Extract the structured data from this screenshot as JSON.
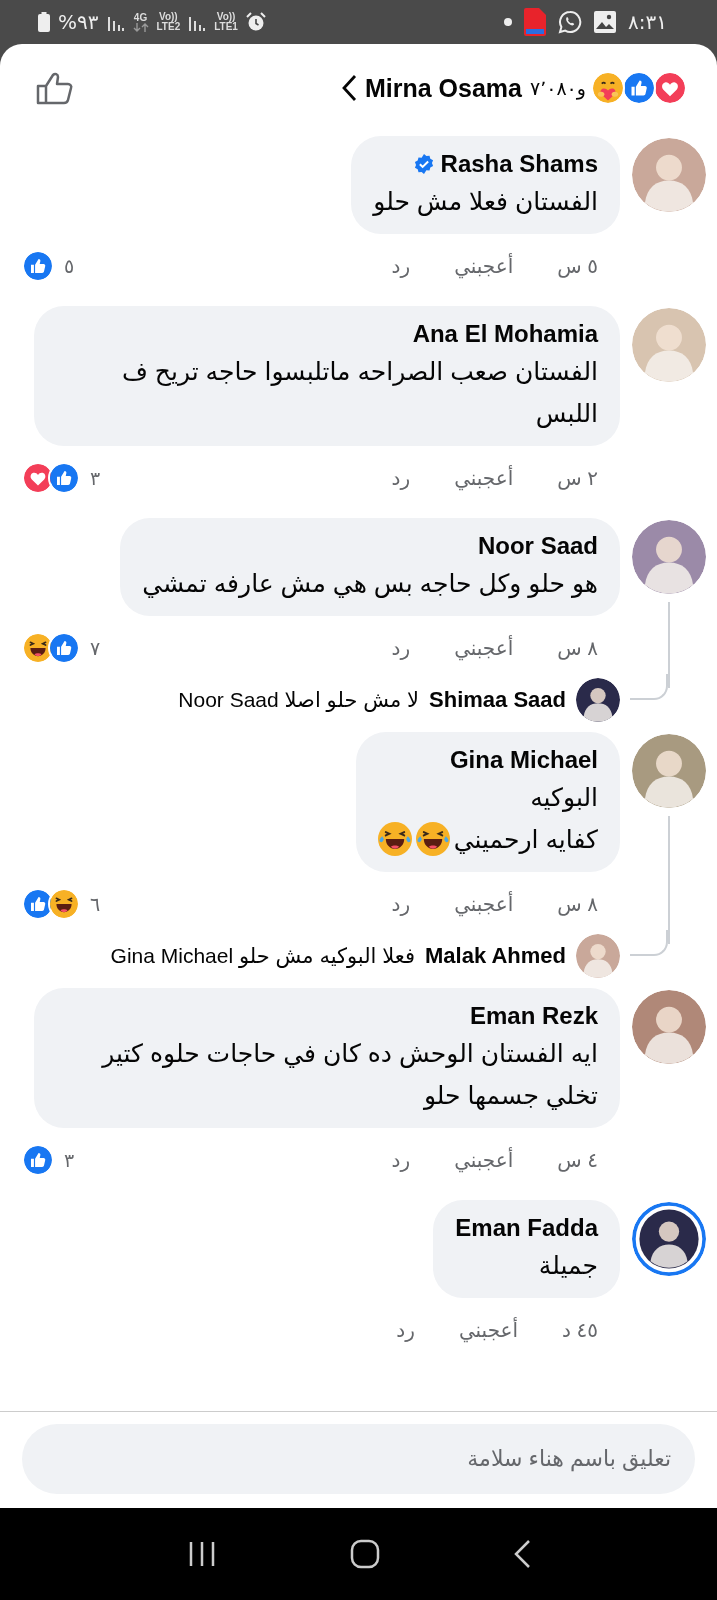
{
  "status_bar": {
    "time": "٨:٣١",
    "battery_text": "%٩٣",
    "network_type": "4G",
    "sim2_top": "Vo))",
    "sim2_bottom": "LTE2",
    "sim1_top": "Vo))",
    "sim1_bottom": "LTE1"
  },
  "header": {
    "reactions": [
      {
        "kind": "love"
      },
      {
        "kind": "like"
      },
      {
        "kind": "care"
      }
    ],
    "count": "و٧٬٠٨٠",
    "name": "Mirna Osama"
  },
  "comments": [
    {
      "name": "Rasha Shams",
      "verified": true,
      "story_ring": false,
      "lines": [
        "الفستان فعلا مش حلو"
      ],
      "time": "٥ س",
      "like_label": "أعجبني",
      "reply_label": "رد",
      "reactions": [
        {
          "kind": "like"
        }
      ],
      "reaction_count": "٥"
    },
    {
      "name": "Ana El Mohamia",
      "verified": false,
      "story_ring": false,
      "lines": [
        "الفستان صعب الصراحه ماتلبسوا حاجه تريح ف اللبس"
      ],
      "time": "٢ س",
      "like_label": "أعجبني",
      "reply_label": "رد",
      "reactions": [
        {
          "kind": "love"
        },
        {
          "kind": "like"
        }
      ],
      "reaction_count": "٣"
    },
    {
      "name": "Noor Saad",
      "verified": false,
      "story_ring": false,
      "lines": [
        "هو حلو وكل حاجه بس هي مش عارفه تمشي"
      ],
      "time": "٨ س",
      "like_label": "أعجبني",
      "reply_label": "رد",
      "reactions": [
        {
          "kind": "haha"
        },
        {
          "kind": "like"
        }
      ],
      "reaction_count": "٧",
      "replies": [
        {
          "name": "Shimaa Saad",
          "text": "لا مش حلو اصلا Noor Saad"
        }
      ]
    },
    {
      "name": "Gina Michael",
      "verified": false,
      "story_ring": false,
      "lines": [
        "البوكيه",
        "كفايه ارحميني"
      ],
      "emojis": [
        {
          "kind": "tears-of-joy"
        },
        {
          "kind": "tears-of-joy"
        }
      ],
      "time": "٨ س",
      "like_label": "أعجبني",
      "reply_label": "رد",
      "reactions": [
        {
          "kind": "like"
        },
        {
          "kind": "haha"
        }
      ],
      "reaction_count": "٦",
      "replies": [
        {
          "name": "Malak Ahmed",
          "text": "فعلا البوكيه مش حلو Gina Michael"
        }
      ]
    },
    {
      "name": "Eman Rezk",
      "verified": false,
      "story_ring": false,
      "lines": [
        "ايه الفستان الوحش ده كان في حاجات حلوه كتير تخلي جسمها حلو"
      ],
      "time": "٤ س",
      "like_label": "أعجبني",
      "reply_label": "رد",
      "reactions": [
        {
          "kind": "like"
        }
      ],
      "reaction_count": "٣"
    },
    {
      "name": "Eman Fadda",
      "verified": false,
      "story_ring": true,
      "lines": [
        "جميلة"
      ],
      "time": "٤٥ د",
      "like_label": "أعجبني",
      "reply_label": "رد"
    }
  ],
  "composer": {
    "placeholder": "تعليق باسم هناء سلامة"
  }
}
